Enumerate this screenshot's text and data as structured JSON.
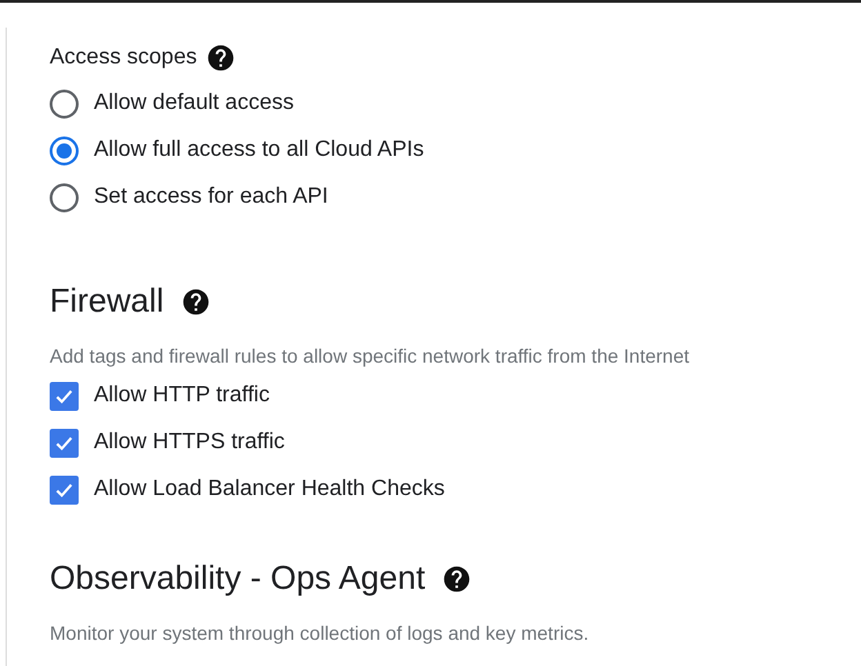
{
  "access_scopes": {
    "label": "Access scopes",
    "options": [
      {
        "label": "Allow default access",
        "selected": false
      },
      {
        "label": "Allow full access to all Cloud APIs",
        "selected": true
      },
      {
        "label": "Set access for each API",
        "selected": false
      }
    ]
  },
  "firewall": {
    "title": "Firewall",
    "description": "Add tags and firewall rules to allow specific network traffic from the Internet",
    "options": [
      {
        "label": "Allow HTTP traffic",
        "checked": true
      },
      {
        "label": "Allow HTTPS traffic",
        "checked": true
      },
      {
        "label": "Allow Load Balancer Health Checks",
        "checked": true
      }
    ]
  },
  "observability": {
    "title": "Observability - Ops Agent",
    "description": "Monitor your system through collection of logs and key metrics."
  }
}
